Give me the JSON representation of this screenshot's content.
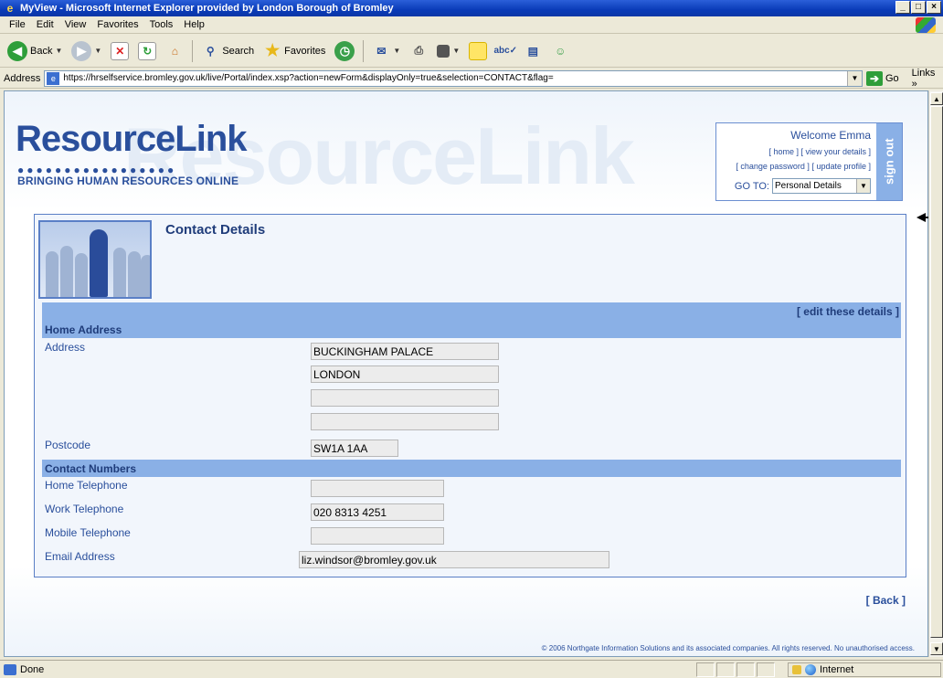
{
  "window": {
    "title": "MyView - Microsoft Internet Explorer provided by London Borough of Bromley"
  },
  "menu": [
    "File",
    "Edit",
    "View",
    "Favorites",
    "Tools",
    "Help"
  ],
  "toolbar": {
    "back_label": "Back",
    "search_label": "Search",
    "favorites_label": "Favorites"
  },
  "address": {
    "label": "Address",
    "url": "https://hrselfservice.bromley.gov.uk/live/Portal/index.xsp?action=newForm&displayOnly=true&selection=CONTACT&flag=",
    "go_label": "Go",
    "links_label": "Links"
  },
  "header": {
    "watermark": "ResourceLink",
    "logo_title": "ResourceLink",
    "logo_dots": "●●●●●●●●●●●●●●●●●",
    "tagline": "BRINGING HUMAN RESOURCES ONLINE"
  },
  "user": {
    "welcome": "Welcome Emma",
    "link_home": "[ home ]",
    "link_view_details": "[ view your details ]",
    "link_change_password": "[ change password ]",
    "link_update_profile": "[ update profile ]",
    "goto_label": "GO TO:",
    "goto_selected": "Personal Details",
    "signout": "sign out"
  },
  "panel": {
    "title": "Contact Details",
    "edit_link": "[ edit these details ]",
    "home_address_heading": "Home Address",
    "address_label": "Address",
    "address_lines": [
      "BUCKINGHAM PALACE",
      "LONDON",
      "",
      ""
    ],
    "postcode_label": "Postcode",
    "postcode": "SW1A 1AA",
    "contact_heading": "Contact Numbers",
    "home_tel_label": "Home Telephone",
    "home_tel": "",
    "work_tel_label": "Work Telephone",
    "work_tel": "020 8313 4251",
    "mobile_label": "Mobile Telephone",
    "mobile": "",
    "email_label": "Email Address",
    "email": "liz.windsor@bromley.gov.uk"
  },
  "footer": {
    "back": "[ Back ]",
    "copyright": "© 2006 Northgate Information Solutions and its associated companies. All rights reserved. No unauthorised access."
  },
  "status": {
    "text": "Done",
    "zone": "Internet"
  }
}
